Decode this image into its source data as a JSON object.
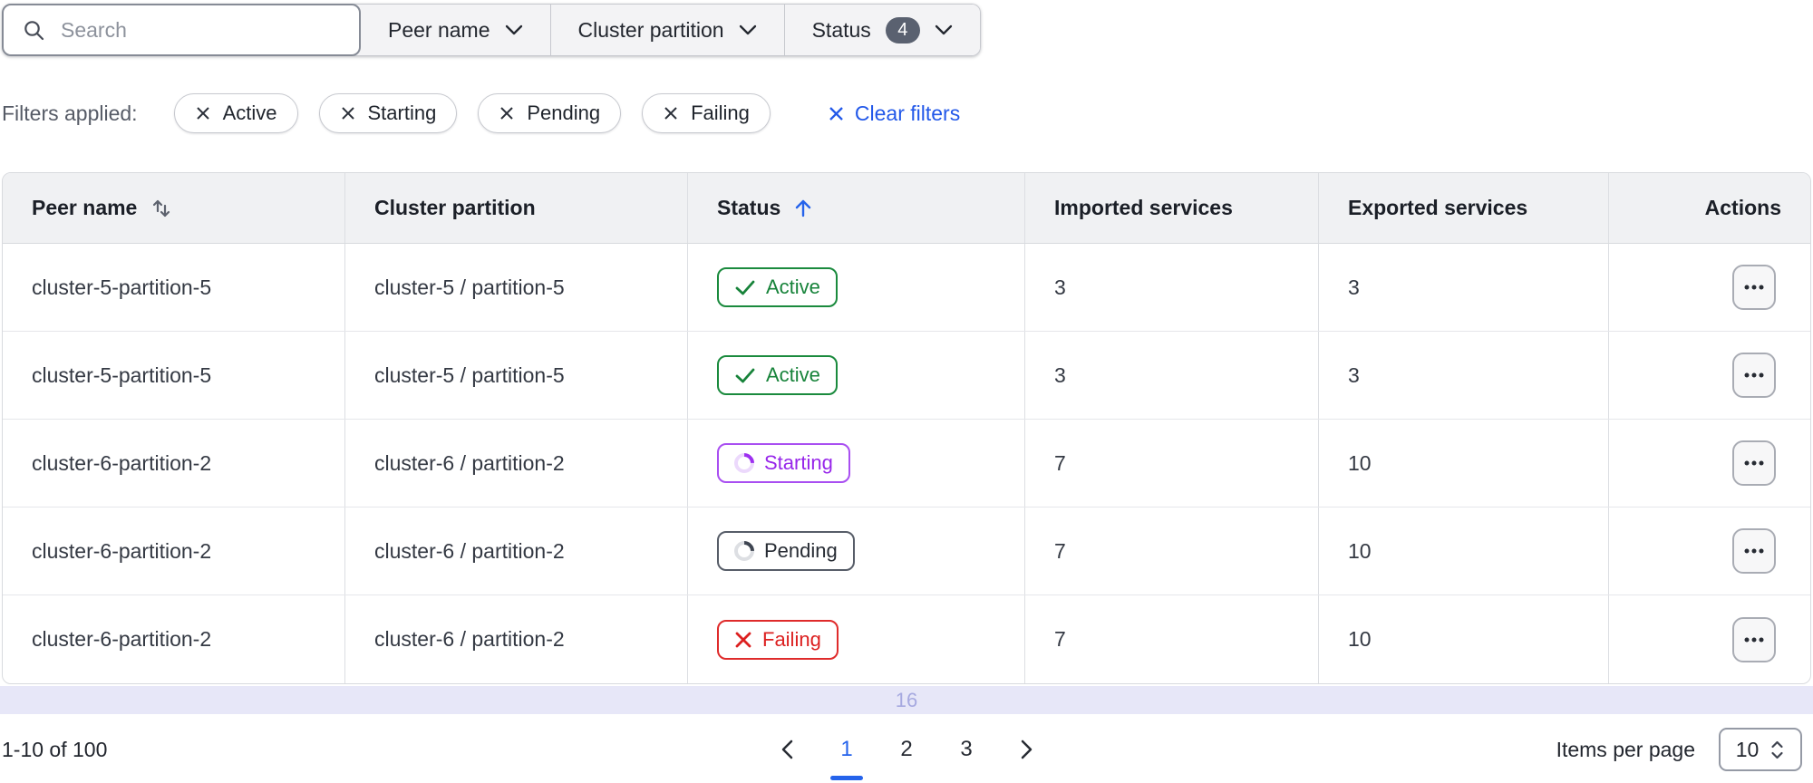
{
  "toolbar": {
    "search": {
      "placeholder": "Search"
    },
    "dropdowns": [
      {
        "label": "Peer name"
      },
      {
        "label": "Cluster partition"
      },
      {
        "label": "Status",
        "badge": "4"
      }
    ]
  },
  "filters": {
    "label": "Filters applied:",
    "chips": [
      "Active",
      "Starting",
      "Pending",
      "Failing"
    ],
    "clear_label": "Clear filters"
  },
  "table": {
    "columns": [
      "Peer name",
      "Cluster partition",
      "Status",
      "Imported services",
      "Exported services",
      "Actions"
    ],
    "sort": {
      "column": "Status",
      "direction": "ascending"
    },
    "rows": [
      {
        "peer": "cluster-5-partition-5",
        "partition": "cluster-5 / partition-5",
        "status": "Active",
        "imported": "3",
        "exported": "3"
      },
      {
        "peer": "cluster-5-partition-5",
        "partition": "cluster-5 / partition-5",
        "status": "Active",
        "imported": "3",
        "exported": "3"
      },
      {
        "peer": "cluster-6-partition-2",
        "partition": "cluster-6 / partition-2",
        "status": "Starting",
        "imported": "7",
        "exported": "10"
      },
      {
        "peer": "cluster-6-partition-2",
        "partition": "cluster-6 / partition-2",
        "status": "Pending",
        "imported": "7",
        "exported": "10"
      },
      {
        "peer": "cluster-6-partition-2",
        "partition": "cluster-6 / partition-2",
        "status": "Failing",
        "imported": "7",
        "exported": "10"
      }
    ],
    "overflow_hint": "16"
  },
  "pagination": {
    "range": "1-10 of 100",
    "pages": [
      "1",
      "2",
      "3"
    ],
    "current_page": "1",
    "items_per_page_label": "Items per page",
    "items_per_page_value": "10"
  },
  "colors": {
    "accent_blue": "#2563eb",
    "link_blue": "#2258e9",
    "status_active": "#17833a",
    "status_starting": "#9726ea",
    "status_pending": "#262b33",
    "status_failing": "#dc2020",
    "selection_bar": "#e7e7f8",
    "header_bg": "#f0f1f3"
  }
}
